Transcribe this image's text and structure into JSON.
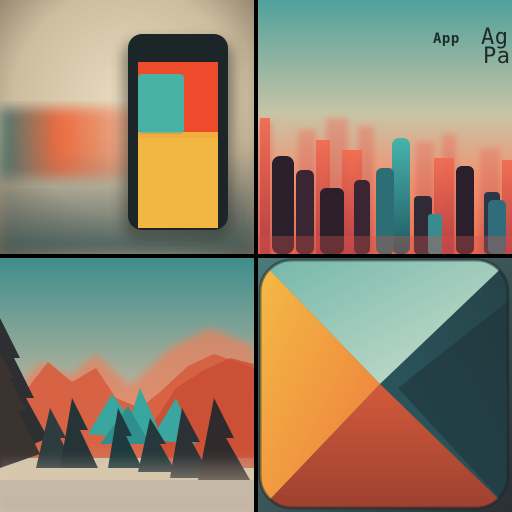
{
  "tiles": {
    "phone": {
      "name": "phone-illustration"
    },
    "city": {
      "name": "city-skyline-illustration",
      "text_word": "App",
      "text_glyphs_1": "Ag",
      "text_glyphs_2": "Pa"
    },
    "mountains": {
      "name": "mountain-landscape-illustration"
    },
    "icon": {
      "name": "gradient-app-icon"
    }
  },
  "palette": {
    "teal": "#3fb0a8",
    "orange": "#f0522b",
    "yellow": "#f1b642",
    "beige": "#d8c9aa",
    "dark": "#1b2330",
    "mist": "#c7b79f"
  }
}
